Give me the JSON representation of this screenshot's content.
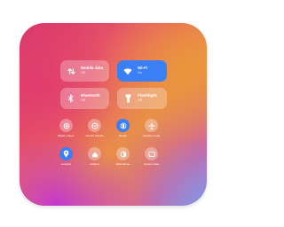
{
  "tiles": [
    {
      "title": "Mobile data",
      "subtitle": "Off",
      "icon": "mobile-data-icon",
      "active": false
    },
    {
      "title": "Wi-Fi",
      "subtitle": "On",
      "icon": "wifi-icon",
      "active": true
    },
    {
      "title": "Bluetooth",
      "subtitle": "Off",
      "icon": "bluetooth-icon",
      "active": false
    },
    {
      "title": "Flashlight",
      "subtitle": "Off",
      "icon": "flashlight-icon",
      "active": false
    }
  ],
  "buttons": [
    {
      "label": "Battery Saver",
      "icon": "battery-saver-icon",
      "active": false
    },
    {
      "label": "Do Not Disturb",
      "icon": "do-not-disturb-icon",
      "active": false
    },
    {
      "label": "Rotate",
      "icon": "rotate-icon",
      "active": true
    },
    {
      "label": "Airplane mode",
      "icon": "airplane-icon",
      "active": false
    },
    {
      "label": "Location",
      "icon": "location-icon",
      "active": true
    },
    {
      "label": "Hotspot",
      "icon": "hotspot-icon",
      "active": false
    },
    {
      "label": "Dark theme",
      "icon": "dark-theme-icon",
      "active": false
    },
    {
      "label": "Screen Cast",
      "icon": "screen-cast-icon",
      "active": false
    }
  ],
  "colors": {
    "accent": "#3b7ff5",
    "tile_inactive": "rgba(255,255,255,0.28)"
  }
}
